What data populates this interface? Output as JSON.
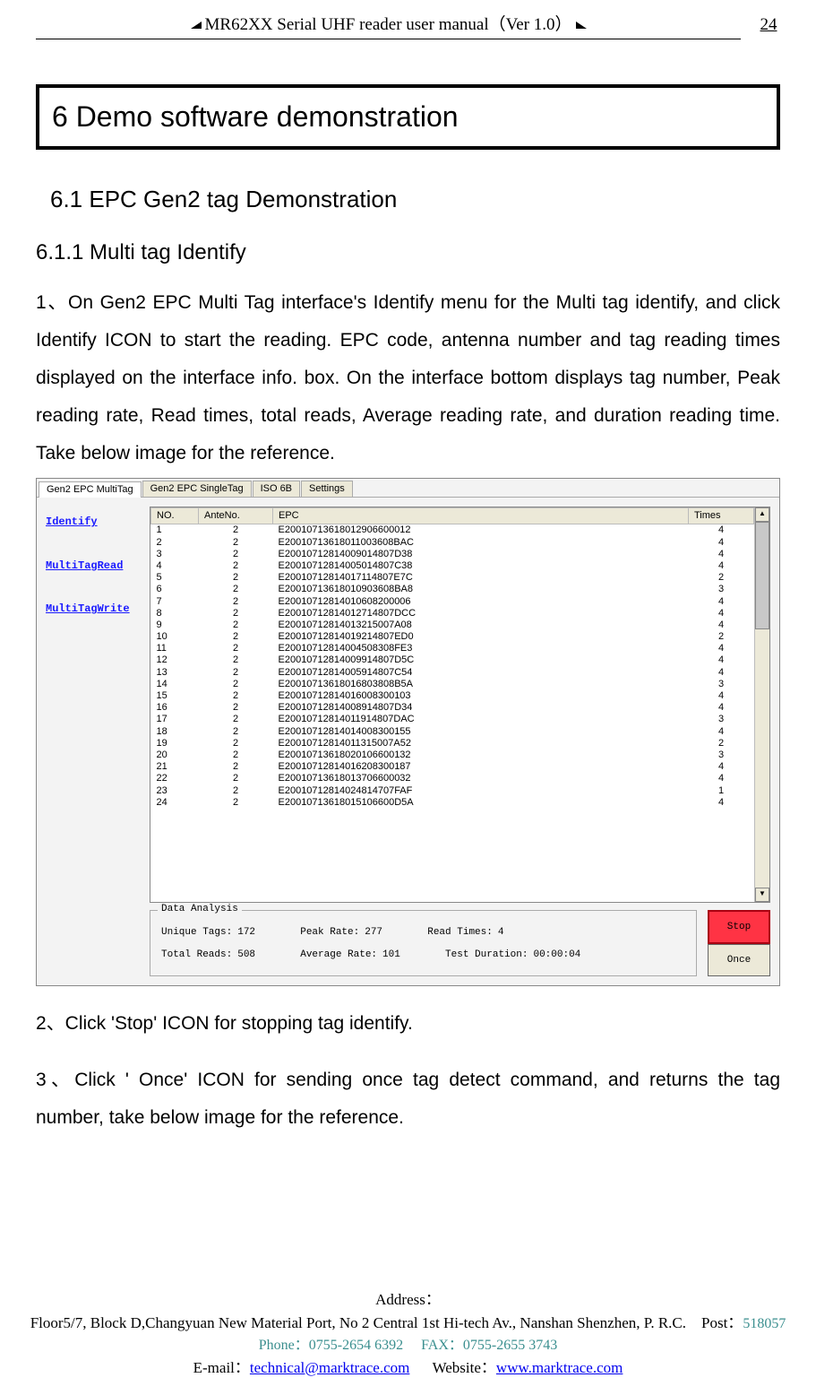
{
  "header": {
    "title": "MR62XX Serial UHF reader user manual（Ver 1.0）",
    "page_number": "24"
  },
  "section_6_title": "6 Demo software demonstration",
  "section_6_1_title": "6.1 EPC Gen2 tag Demonstration",
  "section_6_1_1_title": "6.1.1 Multi tag Identify",
  "para_1": "1、On Gen2 EPC Multi Tag interface's Identify menu for the Multi tag identify, and click Identify ICON to start the reading. EPC code, antenna number and tag reading times displayed on the interface info. box. On the interface bottom displays tag number, Peak reading rate, Read times, total reads, Average reading rate, and duration reading time. Take below image for the reference.",
  "para_2": "2、Click 'Stop' ICON for stopping tag identify.",
  "para_3": "3、Click ' Once' ICON for sending once tag detect command, and returns the tag number,    take below image for the reference.",
  "app": {
    "tabs": {
      "active": "Gen2 EPC MultiTag",
      "t2": "Gen2 EPC SingleTag",
      "t3": "ISO 6B",
      "t4": "Settings"
    },
    "side_links": {
      "identify": "Identify",
      "multiread": "MultiTagRead",
      "multiwrite": "MultiTagWrite"
    },
    "columns": {
      "no": "NO.",
      "ante": "AnteNo.",
      "epc": "EPC",
      "times": "Times"
    },
    "rows": [
      {
        "no": "1",
        "ante": "2",
        "epc": "E20010713618012906600012",
        "times": "4"
      },
      {
        "no": "2",
        "ante": "2",
        "epc": "E20010713618011003608BAC",
        "times": "4"
      },
      {
        "no": "3",
        "ante": "2",
        "epc": "E20010712814009014807D38",
        "times": "4"
      },
      {
        "no": "4",
        "ante": "2",
        "epc": "E20010712814005014807C38",
        "times": "4"
      },
      {
        "no": "5",
        "ante": "2",
        "epc": "E20010712814017114807E7C",
        "times": "2"
      },
      {
        "no": "6",
        "ante": "2",
        "epc": "E20010713618010903608BA8",
        "times": "3"
      },
      {
        "no": "7",
        "ante": "2",
        "epc": "E20010712814010608200006",
        "times": "4"
      },
      {
        "no": "8",
        "ante": "2",
        "epc": "E20010712814012714807DCC",
        "times": "4"
      },
      {
        "no": "9",
        "ante": "2",
        "epc": "E20010712814013215007A08",
        "times": "4"
      },
      {
        "no": "10",
        "ante": "2",
        "epc": "E20010712814019214807ED0",
        "times": "2"
      },
      {
        "no": "11",
        "ante": "2",
        "epc": "E20010712814004508308FE3",
        "times": "4"
      },
      {
        "no": "12",
        "ante": "2",
        "epc": "E20010712814009914807D5C",
        "times": "4"
      },
      {
        "no": "13",
        "ante": "2",
        "epc": "E20010712814005914807C54",
        "times": "4"
      },
      {
        "no": "14",
        "ante": "2",
        "epc": "E20010713618016803808B5A",
        "times": "3"
      },
      {
        "no": "15",
        "ante": "2",
        "epc": "E20010712814016008300103",
        "times": "4"
      },
      {
        "no": "16",
        "ante": "2",
        "epc": "E20010712814008914807D34",
        "times": "4"
      },
      {
        "no": "17",
        "ante": "2",
        "epc": "E20010712814011914807DAC",
        "times": "3"
      },
      {
        "no": "18",
        "ante": "2",
        "epc": "E20010712814014008300155",
        "times": "4"
      },
      {
        "no": "19",
        "ante": "2",
        "epc": "E20010712814011315007A52",
        "times": "2"
      },
      {
        "no": "20",
        "ante": "2",
        "epc": "E20010713618020106600132",
        "times": "3"
      },
      {
        "no": "21",
        "ante": "2",
        "epc": "E20010712814016208300187",
        "times": "4"
      },
      {
        "no": "22",
        "ante": "2",
        "epc": "E20010713618013706600032",
        "times": "4"
      },
      {
        "no": "23",
        "ante": "2",
        "epc": "E20010712814024814707FAF",
        "times": "1"
      },
      {
        "no": "24",
        "ante": "2",
        "epc": "E20010713618015106600D5A",
        "times": "4"
      }
    ],
    "analysis": {
      "label": "Data Analysis",
      "unique_tags_label": "Unique Tags:",
      "unique_tags_value": "172",
      "peak_rate_label": "Peak Rate:",
      "peak_rate_value": "277",
      "read_times_label": "Read Times:",
      "read_times_value": "4",
      "total_reads_label": "Total Reads:",
      "total_reads_value": "508",
      "avg_rate_label": "Average Rate:",
      "avg_rate_value": "101",
      "duration_label": "Test Duration:",
      "duration_value": "00:00:04"
    },
    "buttons": {
      "stop": "Stop",
      "once": "Once"
    }
  },
  "footer": {
    "address_label": "Address：",
    "address_line": "Floor5/7, Block D,Changyuan New  Material Port, No 2 Central 1st Hi-tech Av., Nanshan Shenzhen, P. R.C.",
    "post_label": "Post：",
    "post_value": "518057",
    "phone_label": "Phone：",
    "phone_value": "0755-2654 6392",
    "fax_label": "FAX：",
    "fax_value": "0755-2655 3743",
    "email_label": "E-mail：",
    "email_value": "technical@marktrace.com",
    "website_label": "Website：",
    "website_value": "www.marktrace.com"
  }
}
